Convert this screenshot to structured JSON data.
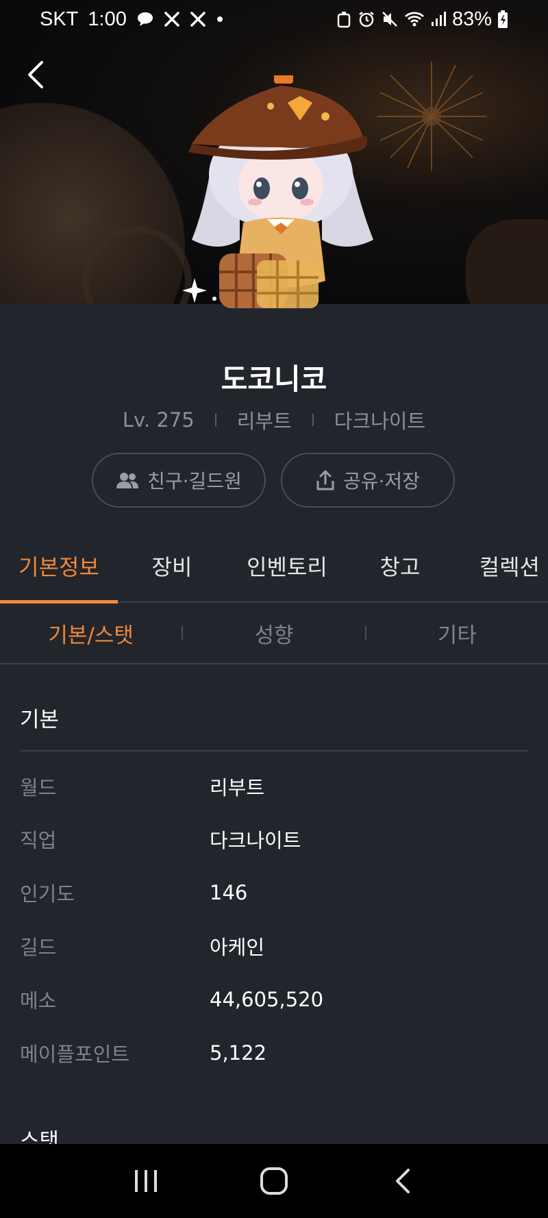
{
  "status_bar": {
    "carrier": "SKT",
    "time": "1:00",
    "battery": "83%"
  },
  "profile": {
    "name": "도코니코",
    "level": "Lv. 275",
    "world": "리부트",
    "job": "다크나이트"
  },
  "actions": {
    "friends_label": "친구·길드원",
    "share_label": "공유·저장"
  },
  "tabs": [
    {
      "label": "기본정보"
    },
    {
      "label": "장비"
    },
    {
      "label": "인벤토리"
    },
    {
      "label": "창고"
    },
    {
      "label": "컬렉션"
    }
  ],
  "subtabs": [
    {
      "label": "기본/스탯"
    },
    {
      "label": "성향"
    },
    {
      "label": "기타"
    }
  ],
  "basic": {
    "title": "기본",
    "rows": [
      {
        "label": "월드",
        "value": "리부트"
      },
      {
        "label": "직업",
        "value": "다크나이트"
      },
      {
        "label": "인기도",
        "value": "146"
      },
      {
        "label": "길드",
        "value": "아케인"
      },
      {
        "label": "메소",
        "value": "44,605,520"
      },
      {
        "label": "메이플포인트",
        "value": "5,122"
      }
    ]
  },
  "stat_section_title": "스탯",
  "colors": {
    "accent": "#f2883a",
    "background": "#22252b",
    "muted": "#7f838b"
  }
}
